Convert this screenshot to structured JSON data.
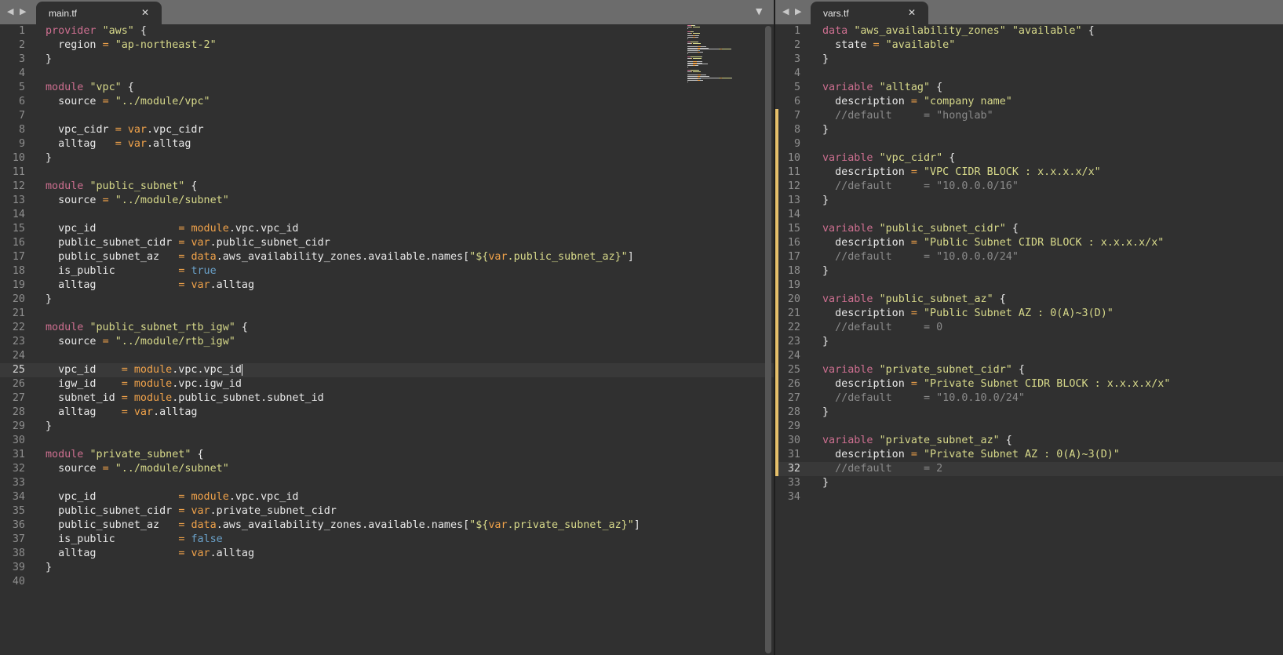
{
  "left": {
    "tab_title": "main.tf",
    "nav_arrows": "◀ ▶",
    "close_glyph": "✕",
    "overflow_glyph": "▼",
    "lines": [
      [
        [
          "kw",
          "provider"
        ],
        [
          "t",
          " "
        ],
        [
          "s",
          "\"aws\""
        ],
        [
          "t",
          " {"
        ]
      ],
      [
        [
          "t",
          "  region "
        ],
        [
          "o",
          "="
        ],
        [
          "t",
          " "
        ],
        [
          "s",
          "\"ap-northeast-2\""
        ]
      ],
      [
        [
          "t",
          "}"
        ]
      ],
      [],
      [
        [
          "kw",
          "module"
        ],
        [
          "t",
          " "
        ],
        [
          "s",
          "\"vpc\""
        ],
        [
          "t",
          " {"
        ]
      ],
      [
        [
          "t",
          "  source "
        ],
        [
          "o",
          "="
        ],
        [
          "t",
          " "
        ],
        [
          "s",
          "\"../module/vpc\""
        ]
      ],
      [],
      [
        [
          "t",
          "  vpc_cidr "
        ],
        [
          "o",
          "="
        ],
        [
          "t",
          " "
        ],
        [
          "v",
          "var"
        ],
        [
          "t",
          ".vpc_cidr"
        ]
      ],
      [
        [
          "t",
          "  alltag   "
        ],
        [
          "o",
          "="
        ],
        [
          "t",
          " "
        ],
        [
          "v",
          "var"
        ],
        [
          "t",
          ".alltag"
        ]
      ],
      [
        [
          "t",
          "}"
        ]
      ],
      [],
      [
        [
          "kw",
          "module"
        ],
        [
          "t",
          " "
        ],
        [
          "s",
          "\"public_subnet\""
        ],
        [
          "t",
          " {"
        ]
      ],
      [
        [
          "t",
          "  source "
        ],
        [
          "o",
          "="
        ],
        [
          "t",
          " "
        ],
        [
          "s",
          "\"../module/subnet\""
        ]
      ],
      [],
      [
        [
          "t",
          "  vpc_id             "
        ],
        [
          "o",
          "="
        ],
        [
          "t",
          " "
        ],
        [
          "v",
          "module"
        ],
        [
          "t",
          ".vpc.vpc_id"
        ]
      ],
      [
        [
          "t",
          "  public_subnet_cidr "
        ],
        [
          "o",
          "="
        ],
        [
          "t",
          " "
        ],
        [
          "v",
          "var"
        ],
        [
          "t",
          ".public_subnet_cidr"
        ]
      ],
      [
        [
          "t",
          "  public_subnet_az   "
        ],
        [
          "o",
          "="
        ],
        [
          "t",
          " "
        ],
        [
          "v",
          "data"
        ],
        [
          "t",
          ".aws_availability_zones.available.names["
        ],
        [
          "s",
          "\"${"
        ],
        [
          "v",
          "var"
        ],
        [
          "s",
          ".public_subnet_az}\""
        ],
        [
          "t",
          "]"
        ]
      ],
      [
        [
          "t",
          "  is_public          "
        ],
        [
          "o",
          "="
        ],
        [
          "t",
          " "
        ],
        [
          "b",
          "true"
        ]
      ],
      [
        [
          "t",
          "  alltag             "
        ],
        [
          "o",
          "="
        ],
        [
          "t",
          " "
        ],
        [
          "v",
          "var"
        ],
        [
          "t",
          ".alltag"
        ]
      ],
      [
        [
          "t",
          "}"
        ]
      ],
      [],
      [
        [
          "kw",
          "module"
        ],
        [
          "t",
          " "
        ],
        [
          "s",
          "\"public_subnet_rtb_igw\""
        ],
        [
          "t",
          " {"
        ]
      ],
      [
        [
          "t",
          "  source "
        ],
        [
          "o",
          "="
        ],
        [
          "t",
          " "
        ],
        [
          "s",
          "\"../module/rtb_igw\""
        ]
      ],
      [],
      [
        [
          "t",
          "  vpc_id    "
        ],
        [
          "o",
          "="
        ],
        [
          "t",
          " "
        ],
        [
          "v",
          "module"
        ],
        [
          "t",
          ".vpc.vpc_id"
        ]
      ],
      [
        [
          "t",
          "  igw_id    "
        ],
        [
          "o",
          "="
        ],
        [
          "t",
          " "
        ],
        [
          "v",
          "module"
        ],
        [
          "t",
          ".vpc.igw_id"
        ]
      ],
      [
        [
          "t",
          "  subnet_id "
        ],
        [
          "o",
          "="
        ],
        [
          "t",
          " "
        ],
        [
          "v",
          "module"
        ],
        [
          "t",
          ".public_subnet.subnet_id"
        ]
      ],
      [
        [
          "t",
          "  alltag    "
        ],
        [
          "o",
          "="
        ],
        [
          "t",
          " "
        ],
        [
          "v",
          "var"
        ],
        [
          "t",
          ".alltag"
        ]
      ],
      [
        [
          "t",
          "}"
        ]
      ],
      [],
      [
        [
          "kw",
          "module"
        ],
        [
          "t",
          " "
        ],
        [
          "s",
          "\"private_subnet\""
        ],
        [
          "t",
          " {"
        ]
      ],
      [
        [
          "t",
          "  source "
        ],
        [
          "o",
          "="
        ],
        [
          "t",
          " "
        ],
        [
          "s",
          "\"../module/subnet\""
        ]
      ],
      [],
      [
        [
          "t",
          "  vpc_id             "
        ],
        [
          "o",
          "="
        ],
        [
          "t",
          " "
        ],
        [
          "v",
          "module"
        ],
        [
          "t",
          ".vpc.vpc_id"
        ]
      ],
      [
        [
          "t",
          "  public_subnet_cidr "
        ],
        [
          "o",
          "="
        ],
        [
          "t",
          " "
        ],
        [
          "v",
          "var"
        ],
        [
          "t",
          ".private_subnet_cidr"
        ]
      ],
      [
        [
          "t",
          "  public_subnet_az   "
        ],
        [
          "o",
          "="
        ],
        [
          "t",
          " "
        ],
        [
          "v",
          "data"
        ],
        [
          "t",
          ".aws_availability_zones.available.names["
        ],
        [
          "s",
          "\"${"
        ],
        [
          "v",
          "var"
        ],
        [
          "s",
          ".private_subnet_az}\""
        ],
        [
          "t",
          "]"
        ]
      ],
      [
        [
          "t",
          "  is_public          "
        ],
        [
          "o",
          "="
        ],
        [
          "t",
          " "
        ],
        [
          "b",
          "false"
        ]
      ],
      [
        [
          "t",
          "  alltag             "
        ],
        [
          "o",
          "="
        ],
        [
          "t",
          " "
        ],
        [
          "v",
          "var"
        ],
        [
          "t",
          ".alltag"
        ]
      ],
      [
        [
          "t",
          "}"
        ]
      ],
      []
    ],
    "current_line": 25
  },
  "right": {
    "tab_title": "vars.tf",
    "nav_arrows": "◀ ▶",
    "close_glyph": "✕",
    "lines": [
      [
        [
          "kw",
          "data"
        ],
        [
          "t",
          " "
        ],
        [
          "s",
          "\"aws_availability_zones\""
        ],
        [
          "t",
          " "
        ],
        [
          "s",
          "\"available\""
        ],
        [
          "t",
          " {"
        ]
      ],
      [
        [
          "t",
          "  state "
        ],
        [
          "o",
          "="
        ],
        [
          "t",
          " "
        ],
        [
          "s",
          "\"available\""
        ]
      ],
      [
        [
          "t",
          "}"
        ]
      ],
      [],
      [
        [
          "kw",
          "variable"
        ],
        [
          "t",
          " "
        ],
        [
          "s",
          "\"alltag\""
        ],
        [
          "t",
          " {"
        ]
      ],
      [
        [
          "t",
          "  description "
        ],
        [
          "o",
          "="
        ],
        [
          "t",
          " "
        ],
        [
          "s",
          "\"company name\""
        ]
      ],
      [
        [
          "c",
          "  //default     = \"honglab\""
        ]
      ],
      [
        [
          "t",
          "}"
        ]
      ],
      [],
      [
        [
          "kw",
          "variable"
        ],
        [
          "t",
          " "
        ],
        [
          "s",
          "\"vpc_cidr\""
        ],
        [
          "t",
          " {"
        ]
      ],
      [
        [
          "t",
          "  description "
        ],
        [
          "o",
          "="
        ],
        [
          "t",
          " "
        ],
        [
          "s",
          "\"VPC CIDR BLOCK : x.x.x.x/x\""
        ]
      ],
      [
        [
          "c",
          "  //default     = \"10.0.0.0/16\""
        ]
      ],
      [
        [
          "t",
          "}"
        ]
      ],
      [],
      [
        [
          "kw",
          "variable"
        ],
        [
          "t",
          " "
        ],
        [
          "s",
          "\"public_subnet_cidr\""
        ],
        [
          "t",
          " {"
        ]
      ],
      [
        [
          "t",
          "  description "
        ],
        [
          "o",
          "="
        ],
        [
          "t",
          " "
        ],
        [
          "s",
          "\"Public Subnet CIDR BLOCK : x.x.x.x/x\""
        ]
      ],
      [
        [
          "c",
          "  //default     = \"10.0.0.0/24\""
        ]
      ],
      [
        [
          "t",
          "}"
        ]
      ],
      [],
      [
        [
          "kw",
          "variable"
        ],
        [
          "t",
          " "
        ],
        [
          "s",
          "\"public_subnet_az\""
        ],
        [
          "t",
          " {"
        ]
      ],
      [
        [
          "t",
          "  description "
        ],
        [
          "o",
          "="
        ],
        [
          "t",
          " "
        ],
        [
          "s",
          "\"Public Subnet AZ : 0(A)~3(D)\""
        ]
      ],
      [
        [
          "c",
          "  //default     = 0"
        ]
      ],
      [
        [
          "t",
          "}"
        ]
      ],
      [],
      [
        [
          "kw",
          "variable"
        ],
        [
          "t",
          " "
        ],
        [
          "s",
          "\"private_subnet_cidr\""
        ],
        [
          "t",
          " {"
        ]
      ],
      [
        [
          "t",
          "  description "
        ],
        [
          "o",
          "="
        ],
        [
          "t",
          " "
        ],
        [
          "s",
          "\"Private Subnet CIDR BLOCK : x.x.x.x/x\""
        ]
      ],
      [
        [
          "c",
          "  //default     = \"10.0.10.0/24\""
        ]
      ],
      [
        [
          "t",
          "}"
        ]
      ],
      [],
      [
        [
          "kw",
          "variable"
        ],
        [
          "t",
          " "
        ],
        [
          "s",
          "\"private_subnet_az\""
        ],
        [
          "t",
          " {"
        ]
      ],
      [
        [
          "t",
          "  description "
        ],
        [
          "o",
          "="
        ],
        [
          "t",
          " "
        ],
        [
          "s",
          "\"Private Subnet AZ : 0(A)~3(D)\""
        ]
      ],
      [
        [
          "c",
          "  //default     = 2"
        ]
      ],
      [
        [
          "t",
          "}"
        ]
      ],
      []
    ],
    "current_line": 32
  },
  "colors": {
    "keyword": "#cd6f90",
    "string": "#d7d98a",
    "variable": "#f0a24a",
    "boolean": "#6aa1c9",
    "comment": "#8a8a8a",
    "modified_marker": "#e6c06a"
  }
}
